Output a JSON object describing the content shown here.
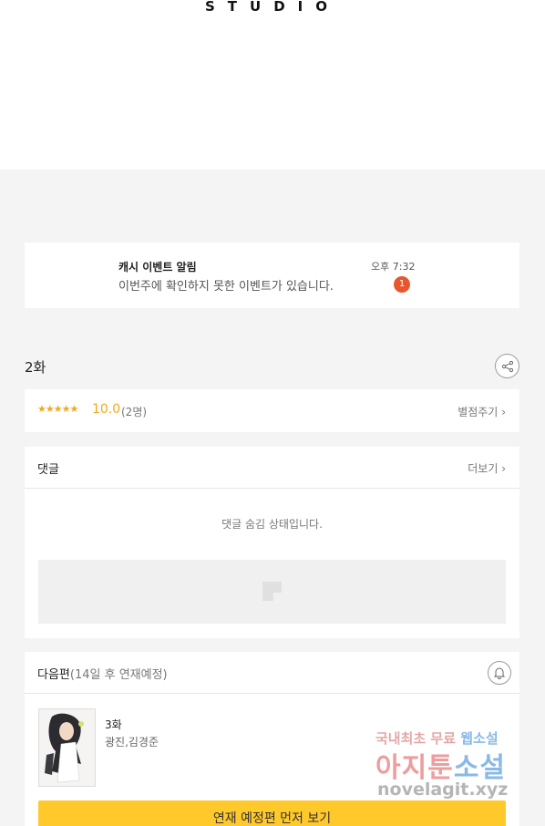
{
  "header": {
    "studio_text": "STUDIO"
  },
  "notification": {
    "title": "캐시 이벤트 알림",
    "message": "이번주에 확인하지 못한 이벤트가 있습니다.",
    "time": "오후 7:32",
    "badge_count": "1"
  },
  "episode": {
    "title": "2화",
    "share_icon": "share-icon"
  },
  "rating": {
    "stars": "★★★★★",
    "score": "10.0",
    "count": "(2명)",
    "rate_link": "별점주기"
  },
  "comments": {
    "title": "댓글",
    "more_link": "더보기",
    "hidden_message": "댓글 숨김 상태입니다."
  },
  "next_episode": {
    "title": "다음편",
    "schedule": "(14일 후 연재예정)",
    "bell_icon": "bell-icon",
    "episode_name": "3화",
    "authors": "광진,김경준",
    "cta_label": "연재 예정편 먼저 보기"
  },
  "watermark": {
    "line1_prefix": "국내최초 무료 ",
    "line1_suffix": "웹소설",
    "line2_prefix": "아지툰",
    "line2_suffix": "소설",
    "line3": "novelagit.xyz"
  },
  "colors": {
    "accent": "#ffc92b",
    "star": "#f5a623",
    "badge": "#e8562e"
  }
}
